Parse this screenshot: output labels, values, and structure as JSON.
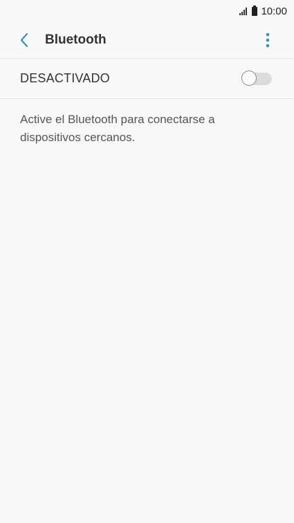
{
  "status_bar": {
    "time": "10:00",
    "signal_icon": "signal-icon",
    "battery_icon": "battery-icon"
  },
  "app_bar": {
    "title": "Bluetooth",
    "back_icon": "back-arrow-icon",
    "more_icon": "more-vert-icon",
    "accent_color": "#3a8fb5"
  },
  "bluetooth_toggle": {
    "label": "DESACTIVADO",
    "state": "off"
  },
  "description": "Active el Bluetooth para conectarse a dispositivos cercanos."
}
